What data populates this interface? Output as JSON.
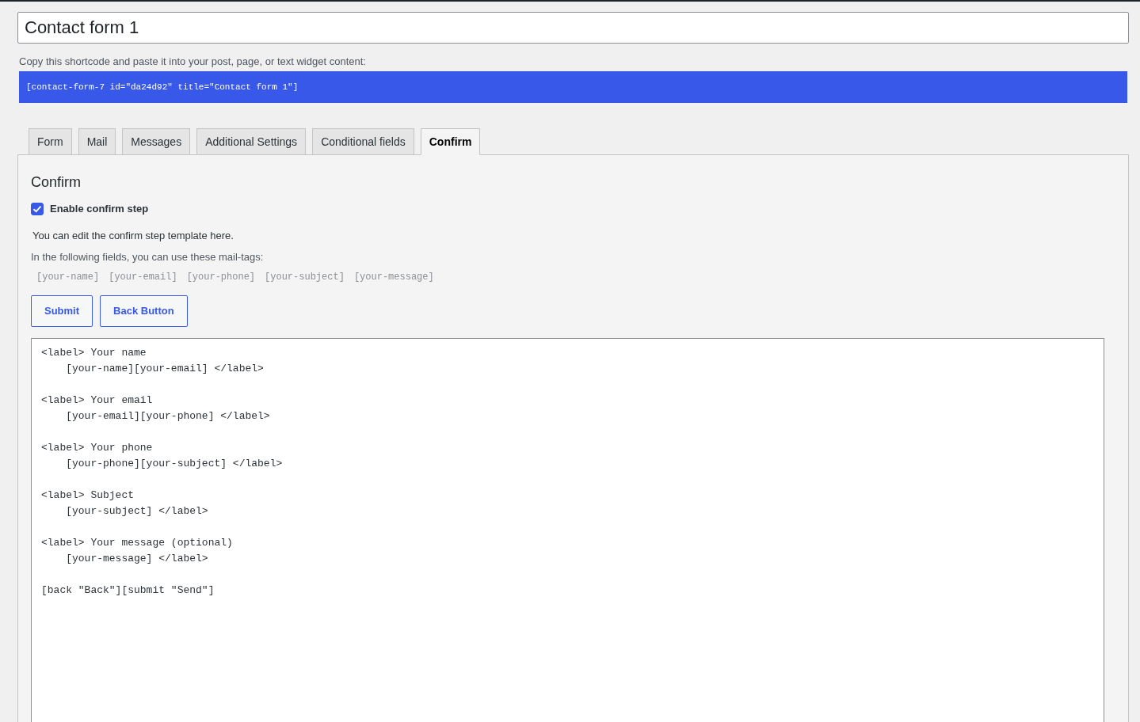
{
  "title_field": {
    "value": "Contact form 1"
  },
  "shortcode_hint": "Copy this shortcode and paste it into your post, page, or text widget content:",
  "shortcode": "[contact-form-7 id=\"da24d92\" title=\"Contact form 1\"]",
  "tabs": [
    {
      "label": "Form",
      "selected": false
    },
    {
      "label": "Mail",
      "selected": false
    },
    {
      "label": "Messages",
      "selected": false
    },
    {
      "label": "Additional Settings",
      "selected": false
    },
    {
      "label": "Conditional fields",
      "selected": false
    },
    {
      "label": "Confirm",
      "selected": true
    }
  ],
  "panel": {
    "heading": "Confirm",
    "enable_confirm": {
      "label": "Enable confirm step",
      "checked": true
    },
    "description": "You can edit the confirm step template here.",
    "mail_tags_hint": "In the following fields, you can use these mail-tags:",
    "mail_tags": [
      "[your-name]",
      "[your-email]",
      "[your-phone]",
      "[your-subject]",
      "[your-message]"
    ],
    "buttons": [
      "Submit",
      "Back Button"
    ],
    "template": "<label> Your name\n    [your-name][your-email] </label>\n\n<label> Your email\n    [your-email][your-phone] </label>\n\n<label> Your phone\n    [your-phone][your-subject] </label>\n\n<label> Subject\n    [your-subject] </label>\n\n<label> Your message (optional)\n    [your-message] </label>\n\n[back \"Back\"][submit \"Send\"]"
  }
}
